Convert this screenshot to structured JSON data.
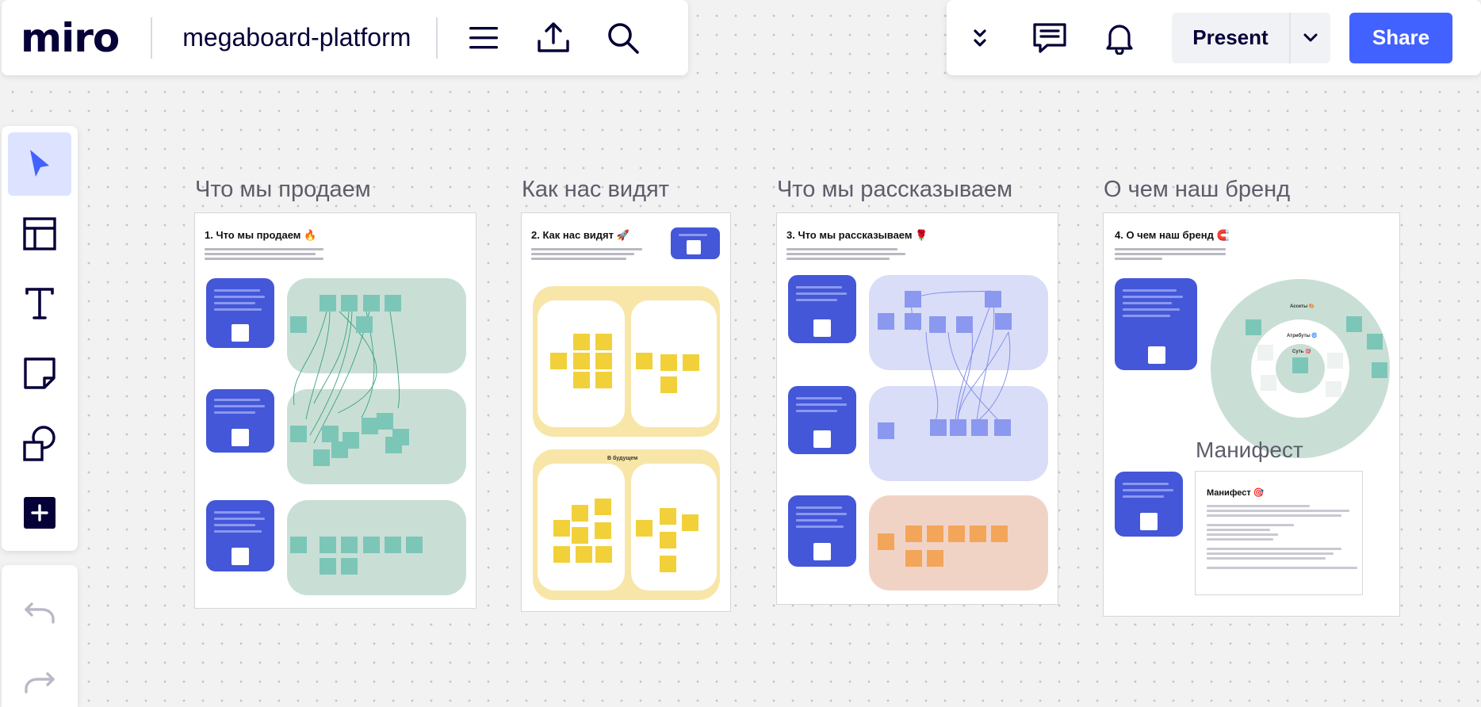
{
  "app": {
    "logo": "miro",
    "board_name": "megaboard-platform"
  },
  "toolbar": {
    "menu_icon": "hamburger-menu-icon",
    "export_icon": "upload-icon",
    "search_icon": "search-icon"
  },
  "topright": {
    "present_label": "Present",
    "share_label": "Share",
    "share_color": "#4262ff"
  },
  "left_tools": [
    "select",
    "templates",
    "text",
    "sticky-note",
    "shapes",
    "add"
  ],
  "frames": [
    {
      "title": "Что мы продаем",
      "inner_title": "1. Что мы продаем 🔥",
      "zone_color": "#c9dfd5",
      "square_color": "#7cc6b8"
    },
    {
      "title": "Как нас видят",
      "inner_title": "2. Как нас видят 🚀",
      "zone_color": "#f8e6a8",
      "sticky_color": "#f2d03a",
      "future_label": "В будущем"
    },
    {
      "title": "Что мы рассказываем",
      "inner_title": "3. Что мы рассказываем 🌹",
      "zone_color": "#d9ddf8",
      "square_color": "#8a98ef",
      "zone3_color": "#f1d3c6",
      "square3_color": "#f3a55a"
    },
    {
      "title": "О чем наш бренд",
      "inner_title": "4. О чем наш бренд 🧲",
      "ring_labels": [
        "Ассеты 🎨",
        "Атрибуты 🌀",
        "Суть 🎯"
      ]
    }
  ],
  "manifest": {
    "title": "Манифест",
    "inner_title": "Манифест 🎯"
  }
}
